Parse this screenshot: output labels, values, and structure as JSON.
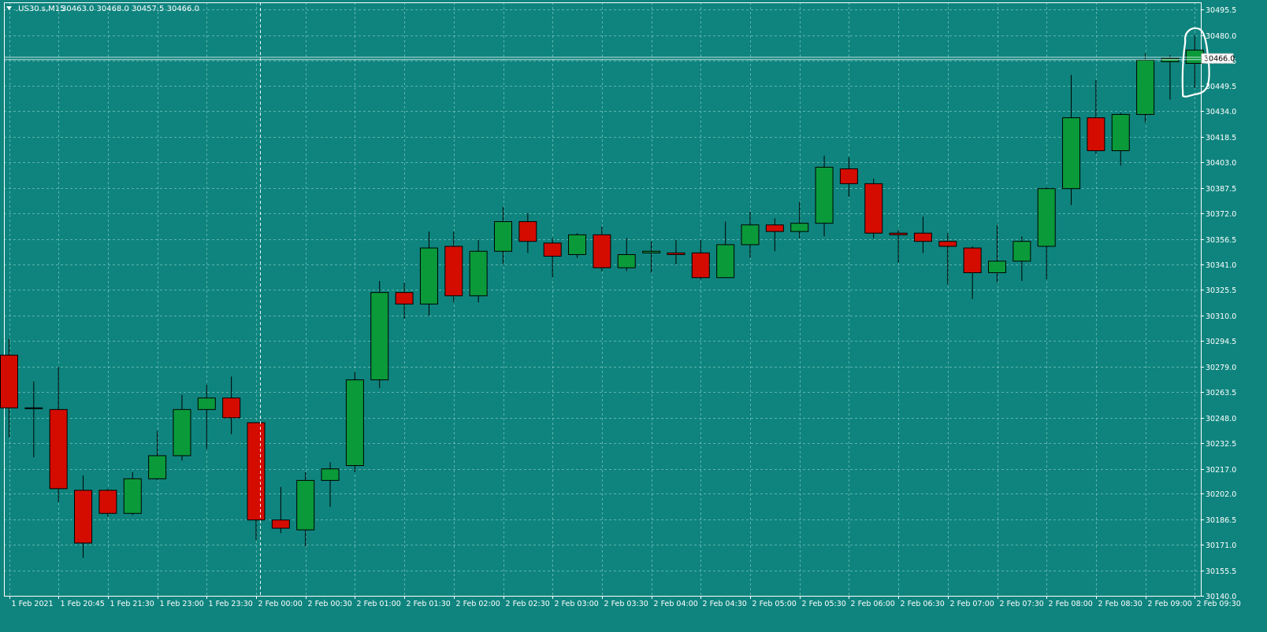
{
  "header": {
    "symbol_text": ".US30.s,M15",
    "ohlc_text": "30463.0 30468.0 30457.5 30466.0",
    "menu_icon": "triangle-down-icon"
  },
  "price_tag": {
    "label": "30466.0",
    "value": 30466.0
  },
  "colors": {
    "background": "#0f847e",
    "grid": "#9fd8d2",
    "bull": "#0a9a3a",
    "bear": "#d40c00",
    "wick": "#000000",
    "frame": "#ffffff",
    "text": "#ffffff",
    "highlight": "#ffffff"
  },
  "chart_data": {
    "type": "candlestick",
    "title": "",
    "ylim": [
      30140.0,
      30500.0
    ],
    "y_ticks": [
      "30495.5",
      "30480.0",
      "30464.5",
      "30449.5",
      "30434.0",
      "30418.5",
      "30403.0",
      "30387.5",
      "30372.0",
      "30356.5",
      "30341.0",
      "30325.5",
      "30310.0",
      "30294.5",
      "30279.0",
      "30263.5",
      "30248.0",
      "30232.5",
      "30217.0",
      "30202.0",
      "30186.5",
      "30171.0",
      "30155.5",
      "30140.0"
    ],
    "x_ticks": [
      {
        "index": 0,
        "label": "1 Feb 2021"
      },
      {
        "index": 2,
        "label": "1 Feb 20:45"
      },
      {
        "index": 4,
        "label": "1 Feb 21:30"
      },
      {
        "index": 6,
        "label": "1 Feb 23:00"
      },
      {
        "index": 8,
        "label": "1 Feb 23:30"
      },
      {
        "index": 10,
        "label": "2 Feb 00:00"
      },
      {
        "index": 12,
        "label": "2 Feb 00:30"
      },
      {
        "index": 14,
        "label": "2 Feb 01:00"
      },
      {
        "index": 16,
        "label": "2 Feb 01:30"
      },
      {
        "index": 18,
        "label": "2 Feb 02:00"
      },
      {
        "index": 20,
        "label": "2 Feb 02:30"
      },
      {
        "index": 22,
        "label": "2 Feb 03:00"
      },
      {
        "index": 24,
        "label": "2 Feb 03:30"
      },
      {
        "index": 26,
        "label": "2 Feb 04:00"
      },
      {
        "index": 28,
        "label": "2 Feb 04:30"
      },
      {
        "index": 30,
        "label": "2 Feb 05:00"
      },
      {
        "index": 32,
        "label": "2 Feb 05:30"
      },
      {
        "index": 34,
        "label": "2 Feb 06:00"
      },
      {
        "index": 36,
        "label": "2 Feb 06:30"
      },
      {
        "index": 38,
        "label": "2 Feb 07:00"
      },
      {
        "index": 40,
        "label": "2 Feb 07:30"
      },
      {
        "index": 42,
        "label": "2 Feb 08:00"
      },
      {
        "index": 44,
        "label": "2 Feb 08:30"
      },
      {
        "index": 46,
        "label": "2 Feb 09:00"
      },
      {
        "index": 48,
        "label": "2 Feb 09:30"
      }
    ],
    "candles": [
      {
        "open": 30286,
        "high": 30296,
        "low": 30236,
        "close": 30254
      },
      {
        "open": 30254,
        "high": 30270,
        "low": 30224,
        "close": 30254
      },
      {
        "open": 30253,
        "high": 30279,
        "low": 30197,
        "close": 30205
      },
      {
        "open": 30204,
        "high": 30213,
        "low": 30163,
        "close": 30172
      },
      {
        "open": 30204,
        "high": 30205,
        "low": 30188,
        "close": 30190
      },
      {
        "open": 30190,
        "high": 30215,
        "low": 30189,
        "close": 30211
      },
      {
        "open": 30211,
        "high": 30240,
        "low": 30210,
        "close": 30225
      },
      {
        "open": 30225,
        "high": 30262,
        "low": 30222,
        "close": 30253
      },
      {
        "open": 30253,
        "high": 30268,
        "low": 30229,
        "close": 30260
      },
      {
        "open": 30260,
        "high": 30273,
        "low": 30238,
        "close": 30248
      },
      {
        "open": 30245,
        "high": 30245,
        "low": 30174,
        "close": 30186
      },
      {
        "open": 30186,
        "high": 30206,
        "low": 30178,
        "close": 30181
      },
      {
        "open": 30180,
        "high": 30215,
        "low": 30170,
        "close": 30210
      },
      {
        "open": 30210,
        "high": 30221,
        "low": 30194,
        "close": 30217
      },
      {
        "open": 30219,
        "high": 30276,
        "low": 30215,
        "close": 30271
      },
      {
        "open": 30271,
        "high": 30331,
        "low": 30266,
        "close": 30324
      },
      {
        "open": 30324,
        "high": 30330,
        "low": 30308,
        "close": 30317
      },
      {
        "open": 30317,
        "high": 30361,
        "low": 30310,
        "close": 30351
      },
      {
        "open": 30352,
        "high": 30361,
        "low": 30318,
        "close": 30322
      },
      {
        "open": 30322,
        "high": 30356,
        "low": 30318,
        "close": 30349
      },
      {
        "open": 30349,
        "high": 30376,
        "low": 30341,
        "close": 30367
      },
      {
        "open": 30367,
        "high": 30372,
        "low": 30348,
        "close": 30355
      },
      {
        "open": 30354,
        "high": 30357,
        "low": 30333,
        "close": 30346
      },
      {
        "open": 30347,
        "high": 30360,
        "low": 30345,
        "close": 30359
      },
      {
        "open": 30359,
        "high": 30364,
        "low": 30337,
        "close": 30339
      },
      {
        "open": 30339,
        "high": 30357,
        "low": 30337,
        "close": 30347
      },
      {
        "open": 30348,
        "high": 30355,
        "low": 30336,
        "close": 30349
      },
      {
        "open": 30348,
        "high": 30356,
        "low": 30341,
        "close": 30347
      },
      {
        "open": 30348,
        "high": 30356,
        "low": 30332,
        "close": 30333
      },
      {
        "open": 30333,
        "high": 30367,
        "low": 30333,
        "close": 30353
      },
      {
        "open": 30353,
        "high": 30373,
        "low": 30345,
        "close": 30365
      },
      {
        "open": 30365,
        "high": 30369,
        "low": 30349,
        "close": 30361
      },
      {
        "open": 30361,
        "high": 30379,
        "low": 30357,
        "close": 30366
      },
      {
        "open": 30366,
        "high": 30407,
        "low": 30358,
        "close": 30400
      },
      {
        "open": 30399,
        "high": 30406,
        "low": 30382,
        "close": 30390
      },
      {
        "open": 30390,
        "high": 30393,
        "low": 30357,
        "close": 30360
      },
      {
        "open": 30360,
        "high": 30362,
        "low": 30342,
        "close": 30359
      },
      {
        "open": 30360,
        "high": 30370,
        "low": 30348,
        "close": 30355
      },
      {
        "open": 30355,
        "high": 30360,
        "low": 30329,
        "close": 30352
      },
      {
        "open": 30351,
        "high": 30352,
        "low": 30320,
        "close": 30336
      },
      {
        "open": 30336,
        "high": 30365,
        "low": 30330,
        "close": 30343
      },
      {
        "open": 30343,
        "high": 30358,
        "low": 30331,
        "close": 30355
      },
      {
        "open": 30352,
        "high": 30388,
        "low": 30332,
        "close": 30387
      },
      {
        "open": 30387,
        "high": 30456,
        "low": 30377,
        "close": 30430
      },
      {
        "open": 30430,
        "high": 30453,
        "low": 30408,
        "close": 30410
      },
      {
        "open": 30410,
        "high": 30433,
        "low": 30401,
        "close": 30432
      },
      {
        "open": 30432,
        "high": 30469,
        "low": 30427,
        "close": 30465
      },
      {
        "open": 30464,
        "high": 30468,
        "low": 30441,
        "close": 30466
      },
      {
        "open": 30463,
        "high": 30480,
        "low": 30448,
        "close": 30471
      }
    ],
    "cursor_index": 10,
    "highlighted_index": 48
  }
}
